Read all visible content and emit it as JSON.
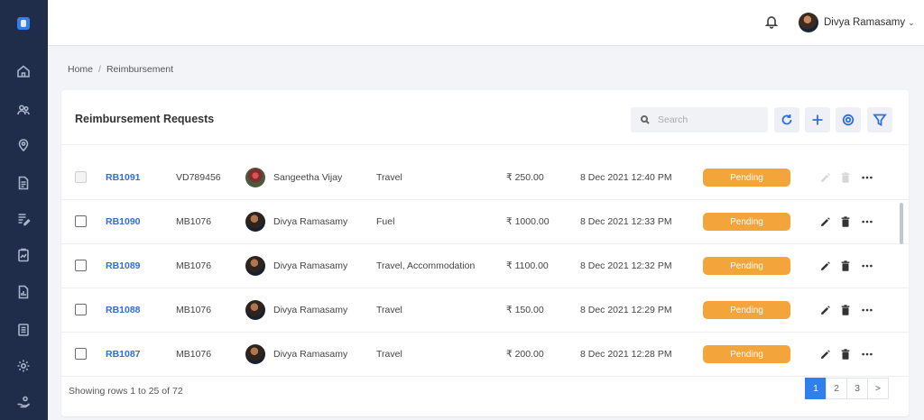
{
  "header": {
    "user_name": "Divya Ramasamy",
    "chevron": "⌄"
  },
  "sidebar": {
    "items": [
      {
        "name": "home-icon"
      },
      {
        "name": "people-icon"
      },
      {
        "name": "location-icon"
      },
      {
        "name": "document-icon"
      },
      {
        "name": "edit-note-icon"
      },
      {
        "name": "clipboard-chart-icon"
      },
      {
        "name": "report-icon"
      },
      {
        "name": "list-icon"
      },
      {
        "name": "gear-icon"
      },
      {
        "name": "hand-money-icon"
      }
    ]
  },
  "breadcrumb": {
    "home": "Home",
    "separator": "/",
    "current": "Reimbursement"
  },
  "card": {
    "title": "Reimbursement Requests",
    "search_placeholder": "Search"
  },
  "rows": [
    {
      "id": "RB1091",
      "vid": "VD789456",
      "employee": "Sangeetha Vijay",
      "category": "Travel",
      "amount": "₹ 250.00",
      "date": "8 Dec 2021 12:40 PM",
      "status": "Pending",
      "disabled": true
    },
    {
      "id": "RB1090",
      "vid": "MB1076",
      "employee": "Divya Ramasamy",
      "category": "Fuel",
      "amount": "₹ 1000.00",
      "date": "8 Dec 2021 12:33 PM",
      "status": "Pending",
      "disabled": false
    },
    {
      "id": "RB1089",
      "vid": "MB1076",
      "employee": "Divya Ramasamy",
      "category": "Travel, Accommodation",
      "amount": "₹ 1100.00",
      "date": "8 Dec 2021 12:32 PM",
      "status": "Pending",
      "disabled": false
    },
    {
      "id": "RB1088",
      "vid": "MB1076",
      "employee": "Divya Ramasamy",
      "category": "Travel",
      "amount": "₹ 150.00",
      "date": "8 Dec 2021 12:29 PM",
      "status": "Pending",
      "disabled": false
    },
    {
      "id": "RB1087",
      "vid": "MB1076",
      "employee": "Divya Ramasamy",
      "category": "Travel",
      "amount": "₹ 200.00",
      "date": "8 Dec 2021 12:28 PM",
      "status": "Pending",
      "disabled": false
    }
  ],
  "footer": {
    "showing": "Showing rows 1 to 25 of 72",
    "pages": [
      "1",
      "2",
      "3",
      ">"
    ],
    "active_page": "1"
  },
  "colors": {
    "sidebar": "#1f2d4b",
    "accent": "#2f80ed",
    "pending": "#f3a43b",
    "link": "#2f6fd8"
  }
}
